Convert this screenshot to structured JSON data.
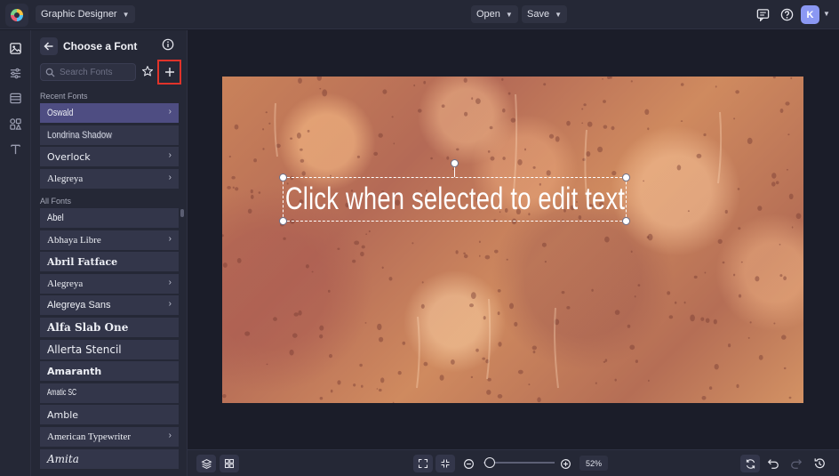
{
  "header": {
    "project_label": "Graphic Designer",
    "open_label": "Open",
    "save_label": "Save",
    "avatar_initial": "K"
  },
  "rail": {
    "items": [
      "image-icon",
      "sliders-icon",
      "layout-icon",
      "shapes-icon",
      "text-icon"
    ]
  },
  "font_panel": {
    "title": "Choose a Font",
    "search_placeholder": "Search Fonts",
    "recent_label": "Recent Fonts",
    "recent_fonts": [
      {
        "name": "Oswald",
        "has_arrow": true,
        "selected": true
      },
      {
        "name": "Londrina Shadow",
        "has_arrow": false
      },
      {
        "name": "Overlock",
        "has_arrow": true
      },
      {
        "name": "Alegreya",
        "has_arrow": true
      }
    ],
    "all_label": "All Fonts",
    "all_fonts": [
      {
        "name": "Abel",
        "has_arrow": false
      },
      {
        "name": "Abhaya Libre",
        "has_arrow": true
      },
      {
        "name": "Abril Fatface",
        "has_arrow": false
      },
      {
        "name": "Alegreya",
        "has_arrow": true
      },
      {
        "name": "Alegreya Sans",
        "has_arrow": true
      },
      {
        "name": "Alfa Slab One",
        "has_arrow": false
      },
      {
        "name": "Allerta Stencil",
        "has_arrow": false
      },
      {
        "name": "Amaranth",
        "has_arrow": false
      },
      {
        "name": "Amatic SC",
        "has_arrow": false
      },
      {
        "name": "Amble",
        "has_arrow": false
      },
      {
        "name": "American Typewriter",
        "has_arrow": true
      },
      {
        "name": "Amita",
        "has_arrow": false
      }
    ]
  },
  "canvas": {
    "text": "Click when selected to edit text"
  },
  "footer": {
    "zoom_label": "52%",
    "zoom_level": 0.52
  },
  "colors": {
    "accent": "#4e4d82",
    "highlight": "#e0332a",
    "avatar": "#8b98f3"
  }
}
